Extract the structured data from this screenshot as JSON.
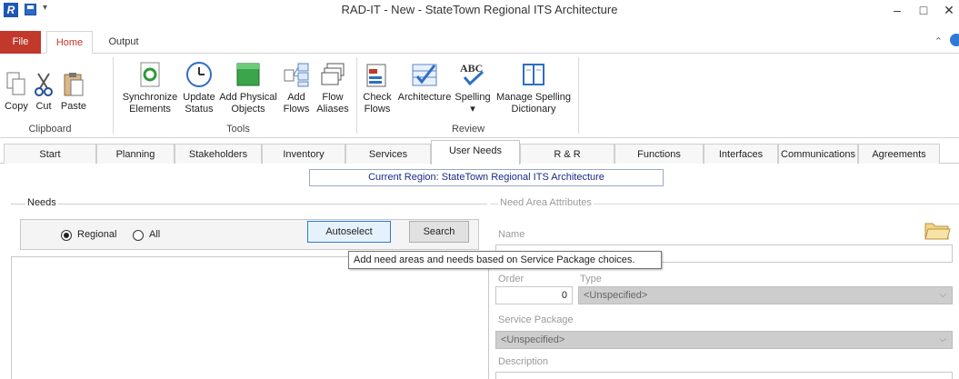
{
  "window": {
    "title": "RAD-IT - New - StateTown Regional ITS Architecture",
    "app_icon_letter": "R",
    "minimize": "–",
    "maximize": "□",
    "close": "✕",
    "qat_dropdown": "▾"
  },
  "ribbon": {
    "tabs": [
      {
        "label": "File"
      },
      {
        "label": "Home"
      },
      {
        "label": "Output"
      }
    ],
    "collapse_glyph": "⌃",
    "groups": {
      "clipboard": {
        "label": "Clipboard",
        "buttons": [
          {
            "label": "Copy",
            "icon": "copy-icon"
          },
          {
            "label": "Cut",
            "icon": "scissors-icon"
          },
          {
            "label": "Paste",
            "icon": "clipboard-icon"
          }
        ]
      },
      "tools": {
        "label": "Tools",
        "buttons": [
          {
            "label1": "Synchronize",
            "label2": "Elements",
            "icon": "sync-icon"
          },
          {
            "label1": "Update",
            "label2": "Status",
            "icon": "clock-icon"
          },
          {
            "label1": "Add Physical",
            "label2": "Objects",
            "icon": "cube-icon"
          },
          {
            "label1": "Add",
            "label2": "Flows",
            "icon": "flows-icon"
          },
          {
            "label1": "Flow",
            "label2": "Aliases",
            "icon": "stack-icon"
          }
        ]
      },
      "review": {
        "label": "Review",
        "buttons": [
          {
            "label1": "Check",
            "label2": "Flows",
            "icon": "check-flows-icon"
          },
          {
            "label1": "Architecture",
            "label2": "",
            "icon": "checklist-icon"
          },
          {
            "label1": "Spelling",
            "label2": "▾",
            "icon": "abc-spell-icon"
          },
          {
            "label1": "Manage Spelling",
            "label2": "Dictionary",
            "icon": "book-icon"
          }
        ]
      }
    }
  },
  "section_tabs": [
    {
      "label": "Start"
    },
    {
      "label": "Planning"
    },
    {
      "label": "Stakeholders"
    },
    {
      "label": "Inventory"
    },
    {
      "label": "Services"
    },
    {
      "label": "User Needs"
    },
    {
      "label": "R & R"
    },
    {
      "label": "Functions"
    },
    {
      "label": "Interfaces"
    },
    {
      "label": "Communications"
    },
    {
      "label": "Agreements"
    }
  ],
  "active_section_tab": "User Needs",
  "current_region": "Current Region: StateTown Regional ITS Architecture",
  "needs": {
    "legend": "Needs",
    "radio_regional": "Regional",
    "radio_all": "All",
    "selected": "Regional",
    "autoselect_label": "Autoselect",
    "search_label": "Search",
    "tooltip": "Add need areas and needs based on Service Package choices."
  },
  "attributes": {
    "legend": "Need Area Attributes",
    "name_label": "Name",
    "name_value": "",
    "order_label": "Order",
    "order_value": "0",
    "type_label": "Type",
    "type_value": "<Unspecified>",
    "service_package_label": "Service Package",
    "service_package_value": "<Unspecified>",
    "description_label": "Description"
  },
  "colors": {
    "file_tab": "#c0392b",
    "accent_blue": "#2e7bd6",
    "region_text": "#1a2a8a"
  }
}
